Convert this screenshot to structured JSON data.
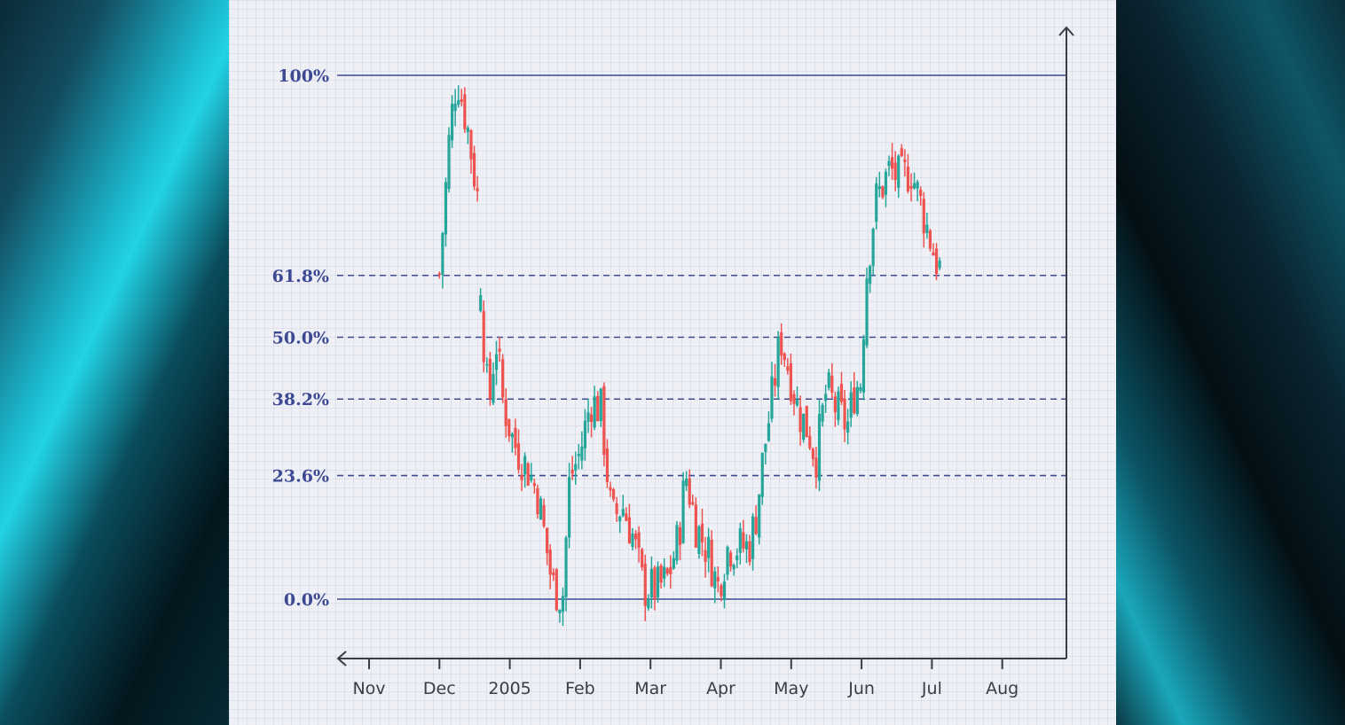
{
  "colors": {
    "up": "#26a69a",
    "down": "#ef5350",
    "level_line": "#3d4a93",
    "axis": "#3a3d45",
    "grid": "#b6bccb"
  },
  "chart_data": {
    "type": "candlestick",
    "title": "",
    "xlabel": "",
    "ylabel": "",
    "x_ticks": [
      "Nov",
      "Dec",
      "2005",
      "Feb",
      "Mar",
      "Apr",
      "May",
      "Jun",
      "Jul",
      "Aug"
    ],
    "levels": [
      {
        "label": "100%",
        "value": 1.0,
        "style": "solid"
      },
      {
        "label": "61.8%",
        "value": 0.618,
        "style": "dashed"
      },
      {
        "label": "50.0%",
        "value": 0.5,
        "style": "dashed"
      },
      {
        "label": "38.2%",
        "value": 0.382,
        "style": "dashed"
      },
      {
        "label": "23.6%",
        "value": 0.236,
        "style": "dashed"
      },
      {
        "label": "0.0%",
        "value": 0.0,
        "style": "solid"
      }
    ],
    "ylim": [
      -0.115,
      1.08
    ],
    "xlim_months": [
      -0.5,
      9.9
    ],
    "series": [
      {
        "x": 1.0,
        "c": 0.62
      },
      {
        "x": 1.15,
        "c": 0.9
      },
      {
        "x": 1.25,
        "c": 1.0
      },
      {
        "x": 1.4,
        "c": 0.9
      },
      {
        "x": 1.55,
        "c": 0.76
      },
      {
        "x": 1.6,
        "c": 0.55
      },
      {
        "x": 1.7,
        "c": 0.36
      },
      {
        "x": 1.8,
        "c": 0.5
      },
      {
        "x": 1.9,
        "c": 0.38
      },
      {
        "x": 2.05,
        "c": 0.3
      },
      {
        "x": 2.25,
        "c": 0.25
      },
      {
        "x": 2.4,
        "c": 0.2
      },
      {
        "x": 2.6,
        "c": 0.03
      },
      {
        "x": 2.75,
        "c": 0.0
      },
      {
        "x": 2.85,
        "c": 0.23
      },
      {
        "x": 3.0,
        "c": 0.28
      },
      {
        "x": 3.15,
        "c": 0.38
      },
      {
        "x": 3.3,
        "c": 0.36
      },
      {
        "x": 3.45,
        "c": 0.15
      },
      {
        "x": 3.6,
        "c": 0.18
      },
      {
        "x": 3.75,
        "c": 0.12
      },
      {
        "x": 3.9,
        "c": 0.02
      },
      {
        "x": 4.1,
        "c": 0.02
      },
      {
        "x": 4.25,
        "c": 0.04
      },
      {
        "x": 4.4,
        "c": 0.12
      },
      {
        "x": 4.5,
        "c": 0.24
      },
      {
        "x": 4.65,
        "c": 0.14
      },
      {
        "x": 4.85,
        "c": 0.08
      },
      {
        "x": 4.95,
        "c": 0.02
      },
      {
        "x": 5.1,
        "c": 0.1
      },
      {
        "x": 5.25,
        "c": 0.1
      },
      {
        "x": 5.4,
        "c": 0.1
      },
      {
        "x": 5.5,
        "c": 0.16
      },
      {
        "x": 5.6,
        "c": 0.27
      },
      {
        "x": 5.7,
        "c": 0.36
      },
      {
        "x": 5.85,
        "c": 0.5
      },
      {
        "x": 6.0,
        "c": 0.42
      },
      {
        "x": 6.1,
        "c": 0.36
      },
      {
        "x": 6.25,
        "c": 0.32
      },
      {
        "x": 6.35,
        "c": 0.27
      },
      {
        "x": 6.5,
        "c": 0.4
      },
      {
        "x": 6.65,
        "c": 0.36
      },
      {
        "x": 6.8,
        "c": 0.33
      },
      {
        "x": 6.9,
        "c": 0.4
      },
      {
        "x": 7.0,
        "c": 0.42
      },
      {
        "x": 7.05,
        "c": 0.6
      },
      {
        "x": 7.2,
        "c": 0.76
      },
      {
        "x": 7.4,
        "c": 0.82
      },
      {
        "x": 7.55,
        "c": 0.8
      },
      {
        "x": 7.7,
        "c": 0.82
      },
      {
        "x": 7.85,
        "c": 0.75
      },
      {
        "x": 8.05,
        "c": 0.65
      },
      {
        "x": 8.15,
        "c": 0.62
      }
    ]
  }
}
